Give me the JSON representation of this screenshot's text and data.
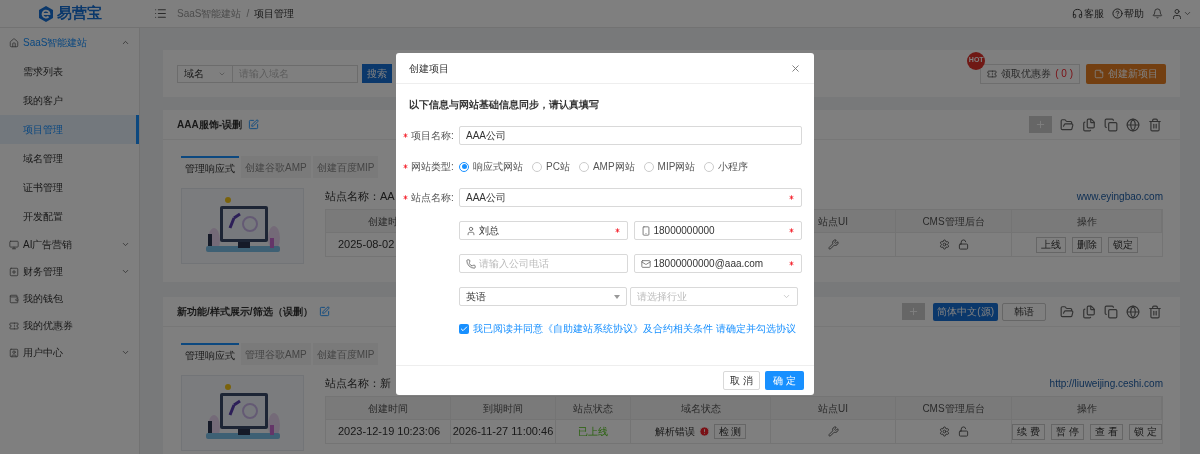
{
  "logo": {
    "text": "易营宝"
  },
  "header": {
    "breadcrumb": [
      "SaaS智能建站",
      "项目管理"
    ],
    "separator": "/",
    "actions": [
      {
        "kind": "support",
        "label": "客服"
      },
      {
        "kind": "help",
        "label": "帮助"
      },
      {
        "kind": "bell"
      },
      {
        "kind": "user"
      }
    ]
  },
  "sidebar": [
    {
      "label": "SaaS智能建站",
      "expanded": true,
      "children": [
        {
          "label": "需求列表",
          "selected": false
        },
        {
          "label": "我的客户",
          "selected": false
        },
        {
          "label": "项目管理",
          "selected": true
        },
        {
          "label": "域名管理",
          "selected": false
        },
        {
          "label": "证书管理",
          "selected": false
        },
        {
          "label": "开发配置",
          "selected": false
        }
      ]
    },
    {
      "label": "AI广告营销",
      "expanded": false
    },
    {
      "label": "财务管理",
      "expanded": false
    },
    {
      "label": "我的钱包"
    },
    {
      "label": "我的优惠券"
    },
    {
      "label": "用户中心",
      "expanded": false
    }
  ],
  "search": {
    "filter": "域名",
    "placeholder": "请输入域名",
    "button": "搜索"
  },
  "hot_badge": "HOT",
  "coupon_button": {
    "label": "领取优惠券",
    "count": "( 0 )"
  },
  "create_button": "创建新项目",
  "projects": [
    {
      "title": "AAA服饰-误删",
      "tabs": [
        {
          "label": "管理响应式",
          "selected": true
        },
        {
          "label": "创建谷歌AMP",
          "selected": false
        },
        {
          "label": "创建百度MIP",
          "selected": false
        }
      ],
      "site_name": "站点名称：AA",
      "url": "www.eyingbao.com",
      "columns": [
        {
          "kind": "created",
          "label": "创建时"
        },
        {
          "kind": "ui",
          "label": "站点UI"
        },
        {
          "kind": "cms",
          "label": "CMS管理后台"
        },
        {
          "kind": "actions",
          "label": "操作"
        }
      ],
      "row": {
        "created": "2025-08-02",
        "actions": [
          "上线",
          "删除",
          "锁定"
        ]
      }
    },
    {
      "title": "新功能/样式展示/筛选（误删）",
      "languages": [
        {
          "label": "简体中文(源)",
          "selected": true
        },
        {
          "label": "韩语",
          "selected": false
        }
      ],
      "tabs": [
        {
          "label": "管理响应式",
          "selected": true
        },
        {
          "label": "管理谷歌AMP",
          "selected": false
        },
        {
          "label": "创建百度MIP",
          "selected": false
        }
      ],
      "site_name": "站点名称：新",
      "url": "http://liuweijing.ceshi.com",
      "columns": [
        {
          "kind": "created",
          "label": "创建时间"
        },
        {
          "kind": "expires",
          "label": "到期时间"
        },
        {
          "kind": "status",
          "label": "站点状态"
        },
        {
          "kind": "domain_status",
          "label": "域名状态"
        },
        {
          "kind": "ui",
          "label": "站点UI"
        },
        {
          "kind": "cms",
          "label": "CMS管理后台"
        },
        {
          "kind": "actions",
          "label": "操作"
        }
      ],
      "row": {
        "created": "2023-12-19 10:23:06",
        "expires": "2026-11-27 11:00:46",
        "status": "已上线",
        "domain_status": {
          "text": "解析错误",
          "error": true,
          "check_button": "检 测"
        },
        "actions": [
          "续 费",
          "暂 停",
          "查 看",
          "锁 定"
        ]
      }
    }
  ],
  "modal": {
    "title": "创建项目",
    "notice": "以下信息与网站基础信息同步，请认真填写",
    "project_name": {
      "label": "项目名称:",
      "required": true,
      "value": "AAA公司"
    },
    "site_type": {
      "label": "网站类型:",
      "required": true,
      "options": [
        {
          "label": "响应式网站",
          "selected": true
        },
        {
          "label": "PC站",
          "selected": false
        },
        {
          "label": "AMP网站",
          "selected": false
        },
        {
          "label": "MIP网站",
          "selected": false
        },
        {
          "label": "小程序",
          "selected": false
        }
      ]
    },
    "site_name": {
      "label": "站点名称:",
      "required": true,
      "marked": true,
      "value": "AAA公司"
    },
    "contacts": [
      {
        "kind": "person",
        "value": "刘总",
        "marked": true
      },
      {
        "kind": "mobile",
        "value": "18000000000",
        "marked": true
      },
      {
        "kind": "phone",
        "placeholder": "请输入公司电话"
      },
      {
        "kind": "email",
        "value": "18000000000@aaa.com",
        "marked": true
      }
    ],
    "language_select": {
      "value": "英语"
    },
    "industry_select": {
      "placeholder": "请选择行业"
    },
    "agreement": {
      "checked": true,
      "text": "我已阅读并同意《自助建站系统协议》及合约相关条件 请确定并勾选协议"
    },
    "buttons": [
      {
        "kind": "cancel",
        "label": "取 消"
      },
      {
        "kind": "confirm",
        "label": "确 定"
      }
    ]
  }
}
